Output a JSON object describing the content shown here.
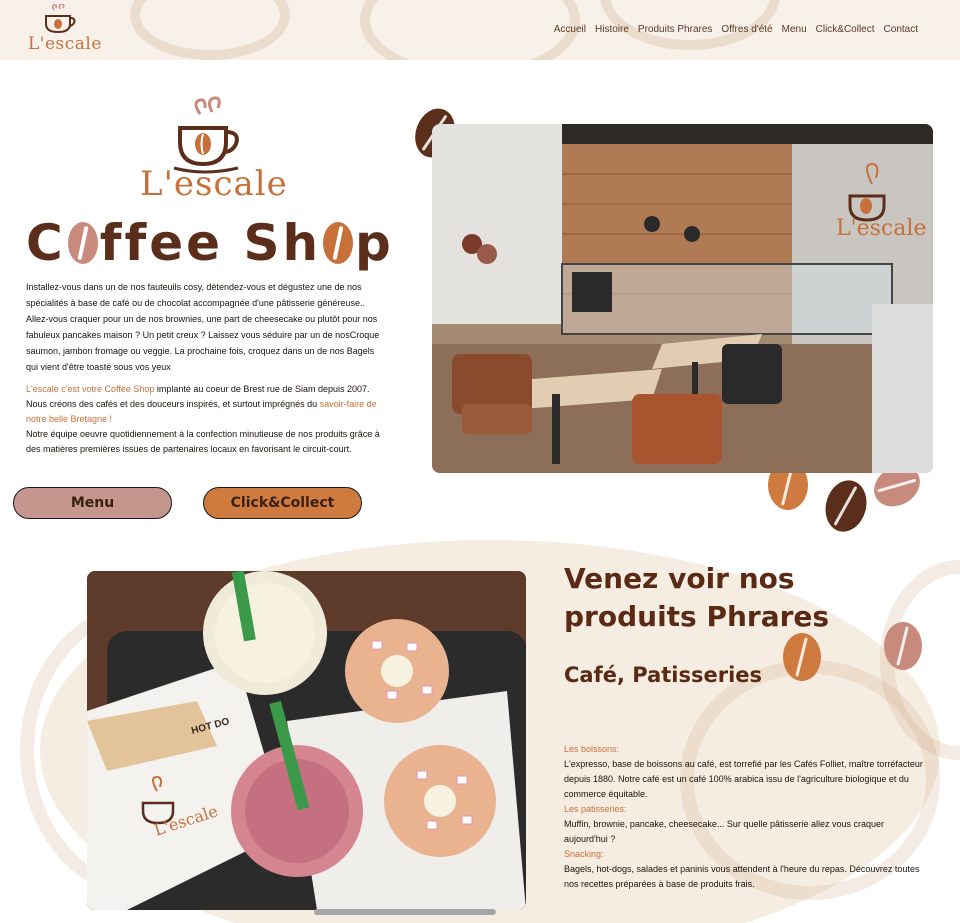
{
  "header": {
    "logo_text": "L'escale",
    "nav": [
      "Accueil",
      "Histoire",
      "Produits Phrares",
      "Offres d'été",
      "Menu",
      "Click&Collect",
      "Contact"
    ]
  },
  "hero": {
    "logo_text": "L'escale",
    "title_part1": "C",
    "title_part2": "ffee Sh",
    "title_part3": "p",
    "intro": "Installez-vous dans un de nos fauteuils cosy, détendez-vous et dégustez une de nos spécialités à base de café ou de chocolat accompagnée d'une pâtisserie généreuse.. Allez-vous craquer pour un de nos brownies, une part de cheesecake ou plutôt pour nos fabuleux pancakes maison ? Un petit creux ? Laissez vous séduire par un de nosCroque saumon, jambon fromage ou veggie. La prochaine fois, croquez dans un de nos Bagels qui vient d'être toasté sous vos yeux",
    "story_accent": "L'escale c'est votre Coffee Shop",
    "story_text1": " implanté au coeur de  Brest rue de Siam depuis 2007. Nous créons des cafés et des douceurs inspirés, et surtout imprégnés du ",
    "story_accent2": "savoir-faire de notre belle Bretagne !",
    "story_text2": "Notre équipe oeuvre quotidiennement à la confection minutieuse de nos produits grâce à des matières premières issues de partenaires locaux en favorisant le circuit-court.",
    "menu_button": "Menu",
    "click_button": "Click&Collect",
    "photo_logo_text": "L'escale"
  },
  "products": {
    "title": "Venez voir nos produits Phrares",
    "subtitle": "Café, Patisseries",
    "boissons_label": "Les boissons:",
    "boissons_text": "L'expresso, base de boissons au café, est torrefié par les Cafés Folliet, maître torréfacteur depuis 1880. Notre café est un café 100% arabica issu de l'agriculture biologique et du commerce équitable.",
    "patisseries_label": "Les patisseries:",
    "patisseries_text": "Muffin, brownie, pancake, cheesecake... Sur quelle pâtisserie allez vous craquer aujourd'hui ?",
    "snacking_label": "Snacking:",
    "snacking_text": "Bagels, hot-dogs, salades et paninis vous attendent à l'heure du repas. Découvrez toutes nos recettes préparées à base de produits frais.",
    "photo_logo_text": "L'escale",
    "photo_tray_text": "HOT DO"
  },
  "colors": {
    "accent": "#c7703a",
    "brown": "#5a2e1a",
    "pink": "#c4968d",
    "cream": "#f7f1ea"
  }
}
